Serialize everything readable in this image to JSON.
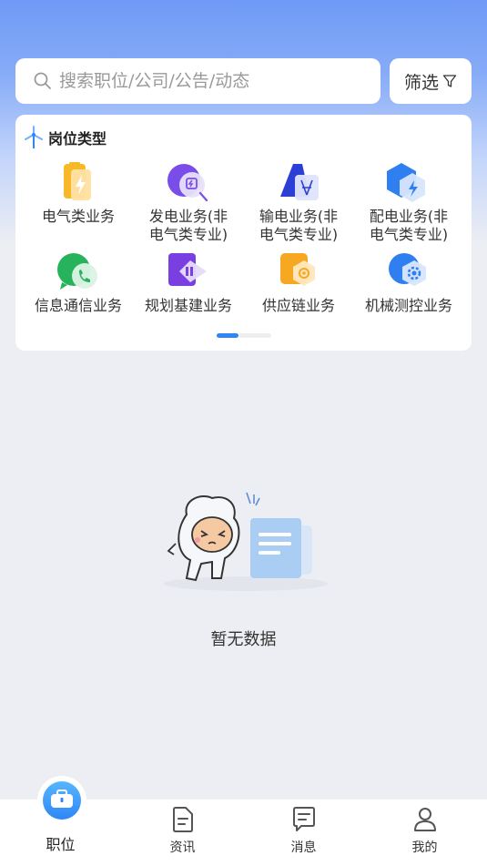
{
  "search": {
    "placeholder": "搜索职位/公司/公告/动态"
  },
  "filter": {
    "label": "筛选"
  },
  "job_types": {
    "title": "岗位类型",
    "items": [
      {
        "label": "电气类业务",
        "icon": "battery-icon"
      },
      {
        "label": "发电业务(非\n电气类专业)",
        "icon": "power-generation-icon"
      },
      {
        "label": "输电业务(非\n电气类专业)",
        "icon": "transmission-icon"
      },
      {
        "label": "配电业务(非\n电气类专业)",
        "icon": "distribution-icon"
      },
      {
        "label": "信息通信业务",
        "icon": "phone-chat-icon"
      },
      {
        "label": "规划基建业务",
        "icon": "planning-icon"
      },
      {
        "label": "供应链业务",
        "icon": "supply-chain-icon"
      },
      {
        "label": "机械测控业务",
        "icon": "gear-icon"
      }
    ],
    "page_indicator": {
      "current": 1,
      "total": 2
    }
  },
  "empty_state": {
    "text": "暂无数据"
  },
  "tabbar": {
    "items": [
      {
        "label": "职位",
        "icon": "job-icon",
        "active": true
      },
      {
        "label": "资讯",
        "icon": "document-icon",
        "active": false
      },
      {
        "label": "消息",
        "icon": "message-icon",
        "active": false
      },
      {
        "label": "我的",
        "icon": "user-icon",
        "active": false
      }
    ]
  },
  "colors": {
    "accent": "#2f86f6",
    "header_gradient_top": "#6f9af6"
  }
}
